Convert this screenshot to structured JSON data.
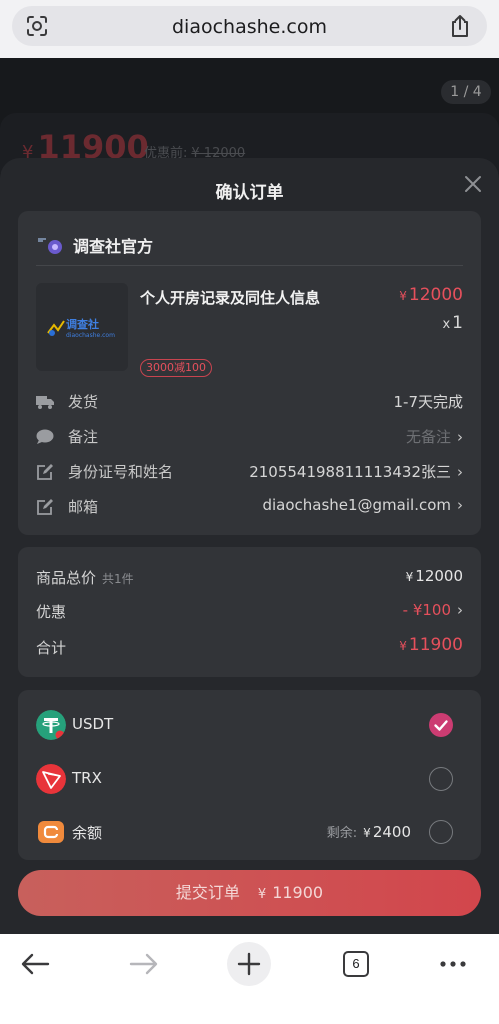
{
  "browser": {
    "url": "diaochashe.com",
    "tab_count": "6"
  },
  "background_page": {
    "pager": "1 / 4",
    "price_symbol": "¥",
    "price": "11900",
    "orig_label": "优惠前:",
    "orig_price": "¥ 12000"
  },
  "sheet": {
    "title": "确认订单",
    "shop_name": "调查社官方",
    "product": {
      "name": "个人开房记录及同住人信息",
      "price_symbol": "¥",
      "price": "12000",
      "qty_prefix": "x",
      "qty": "1",
      "coupon": "3000减100",
      "thumb_brand": "调查社",
      "thumb_url": "diaochashe.com"
    },
    "rows": [
      {
        "label": "发货",
        "value": "1-7天完成",
        "icon": "truck-icon"
      },
      {
        "label": "备注",
        "value": "无备注",
        "icon": "comment-icon"
      },
      {
        "label": "身份证号和姓名",
        "value": "210554198811113432张三",
        "icon": "edit-icon"
      },
      {
        "label": "邮箱",
        "value": "diaochashe1@gmail.com",
        "icon": "edit-icon"
      }
    ],
    "summary": {
      "total_label": "商品总价",
      "total_count": "共1件",
      "total_symbol": "¥",
      "total_value": "12000",
      "discount_label": "优惠",
      "discount_value": "- ¥100",
      "sum_label": "合计",
      "sum_symbol": "¥",
      "sum_value": "11900"
    },
    "payments": [
      {
        "name": "USDT",
        "selected": true
      },
      {
        "name": "TRX",
        "selected": false
      },
      {
        "name": "余额",
        "selected": false,
        "remain_label": "剩余:",
        "remain_symbol": "¥",
        "remain_value": "2400"
      }
    ],
    "submit": {
      "label": "提交订单",
      "symbol": "¥",
      "amount": "11900"
    }
  },
  "colors": {
    "accent_red": "#e5505c",
    "sheet_bg": "#26282c",
    "card_bg": "#323438",
    "checked": "#cc3c72",
    "usdt_green": "#26a17b",
    "trx_red": "#e8343a",
    "wallet_orange": "#f08a3c"
  }
}
